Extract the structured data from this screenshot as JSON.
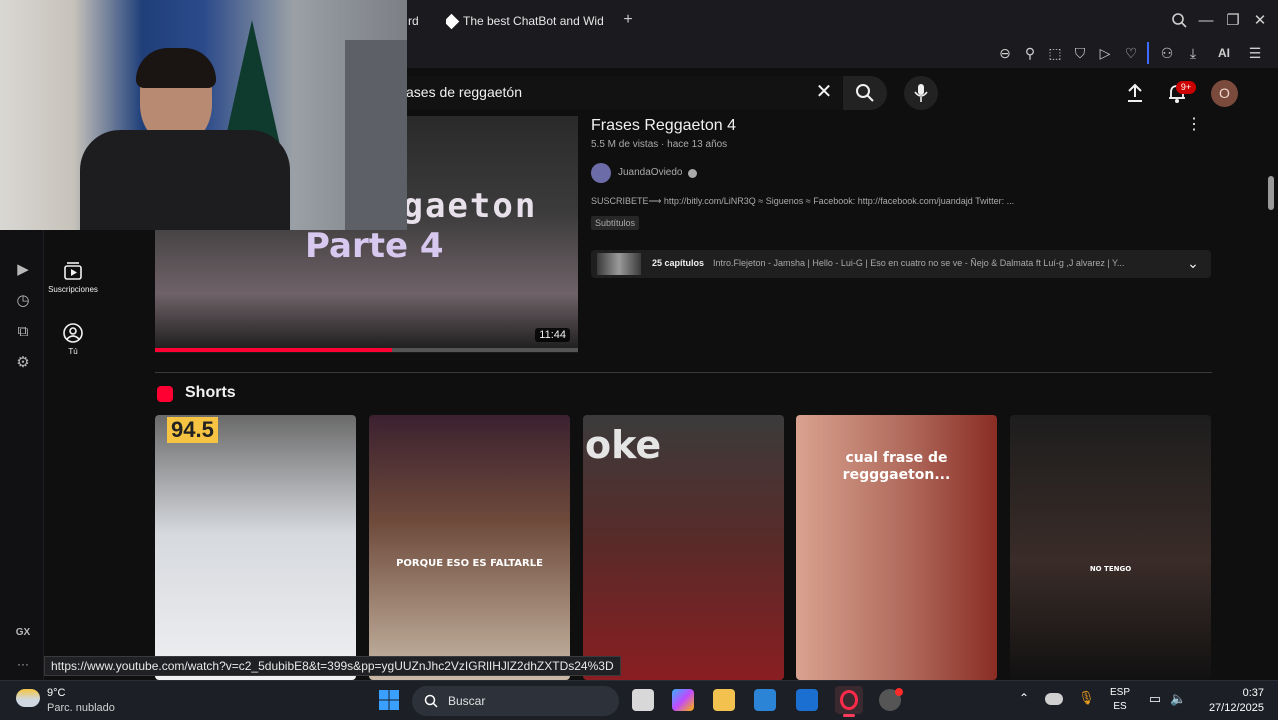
{
  "browser": {
    "tabs": [
      {
        "label": "rd"
      },
      {
        "label": "The best ChatBot and Wid"
      }
    ],
    "ai_label": "AI"
  },
  "youtube": {
    "search": {
      "value": "ases de reggaetón"
    },
    "notifications_badge": "9+",
    "avatar_letter": "O",
    "guide": [
      {
        "label": "Suscripciones"
      },
      {
        "label": "Tú"
      }
    ],
    "video": {
      "title": "Frases Reggaeton 4",
      "meta": "5.5 M de vistas · hace 13 años",
      "channel": "JuandaOviedo",
      "description": "SUSCRIBETE⟶ http://bitly.com/LiNR3Q ≈ Siguenos ≈ Facebook: http://facebook.com/juandajd Twitter: ...",
      "badge": "Subtítulos",
      "chapters_count": "25 capítulos",
      "chapters_text": "Intro.Flejeton - Jamsha | Hello - Lui-G | Eso en cuatro no se ve - Ñejo & Dalmata ft Luí-g ,J alvarez | Y...",
      "duration": "11:44",
      "thumb_text_1": "ggaeton",
      "thumb_text_2": "Parte 4",
      "progress": 0.56
    },
    "shorts": {
      "title": "Shorts",
      "items": [
        {
          "caption": "94.5",
          "bg": "#e9e9ea"
        },
        {
          "caption": "PORQUE ESO ES FALTARLE",
          "bg": "#5b3b2f"
        },
        {
          "caption": "oke",
          "bg": "#4a2a26"
        },
        {
          "caption": "cual frase de regggaeton...",
          "bg": "#b9766a"
        },
        {
          "caption": "NO TENGO",
          "bg": "#1a1a1a"
        }
      ]
    }
  },
  "status_url": "https://www.youtube.com/watch?v=c2_5dubibE8&t=399s&pp=ygUUZnJhc2VzIGRlIHJlZ2dhZXTDs24%3D",
  "opera_sidebar": {
    "gx_label": "GX",
    "more_label": "···"
  },
  "taskbar": {
    "weather_temp": "9°C",
    "weather_desc": "Parc. nublado",
    "search_label": "Buscar",
    "lang_1": "ESP",
    "lang_2": "ES",
    "time": "0:37",
    "date": "27/12/2025"
  },
  "colors": {
    "accent": "#ff0033",
    "taskbar": "#1c1f26",
    "bg": "#0f0f0f"
  }
}
